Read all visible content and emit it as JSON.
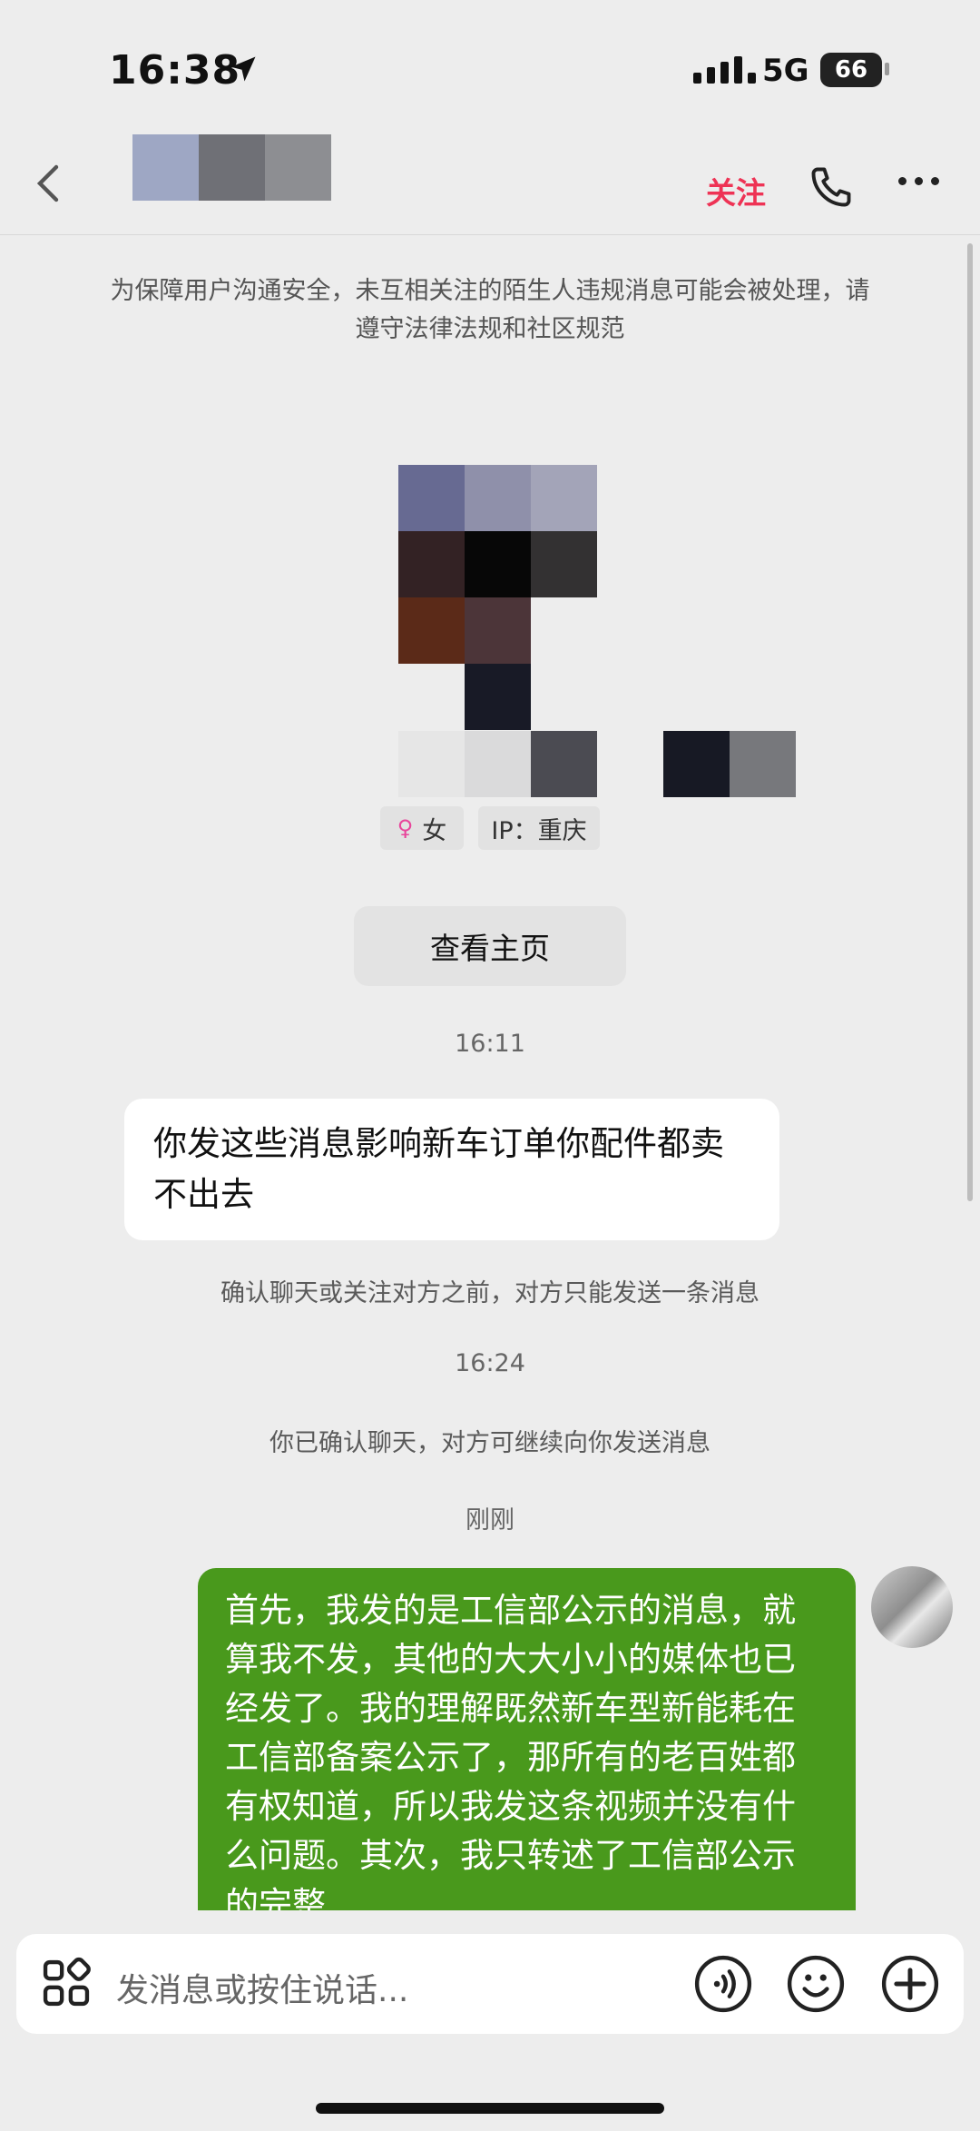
{
  "status_bar": {
    "time": "16:38",
    "network": "5G",
    "battery": "66"
  },
  "header": {
    "follow_label": "关注"
  },
  "notice": "为保障用户沟通安全，未互相关注的陌生人违规消息可能会被处理，请遵守法律法规和社区规范",
  "profile": {
    "gender_icon": "♀",
    "gender": "女",
    "ip": "IP：重庆",
    "view_home_label": "查看主页"
  },
  "messages": {
    "ts1": "16:11",
    "incoming": "你发这些消息影响新车订单你配件都卖不出去",
    "sys1": "确认聊天或关注对方之前，对方只能发送一条消息",
    "ts2": "16:24",
    "sys2": "你已确认聊天，对方可继续向你发送消息",
    "ts3": "刚刚",
    "outgoing": "首先，我发的是工信部公示的消息，就算我不发，其他的大大小小的媒体也已经发了。我的理解既然新车型新能耗在工信部备案公示了，那所有的老百姓都有权知道，所以我发这条视频并没有什么问题。其次，我只转述了工信部公示的完整"
  },
  "input": {
    "placeholder": "发消息或按住说话..."
  },
  "colors": {
    "accent_follow": "#ee3355",
    "outgoing_bubble": "#49991c"
  },
  "icons": [
    "location-arrow-icon",
    "signal-icon",
    "back-chevron-icon",
    "phone-icon",
    "more-icon",
    "female-icon",
    "apps-icon",
    "voice-icon",
    "emoji-icon",
    "plus-icon"
  ]
}
